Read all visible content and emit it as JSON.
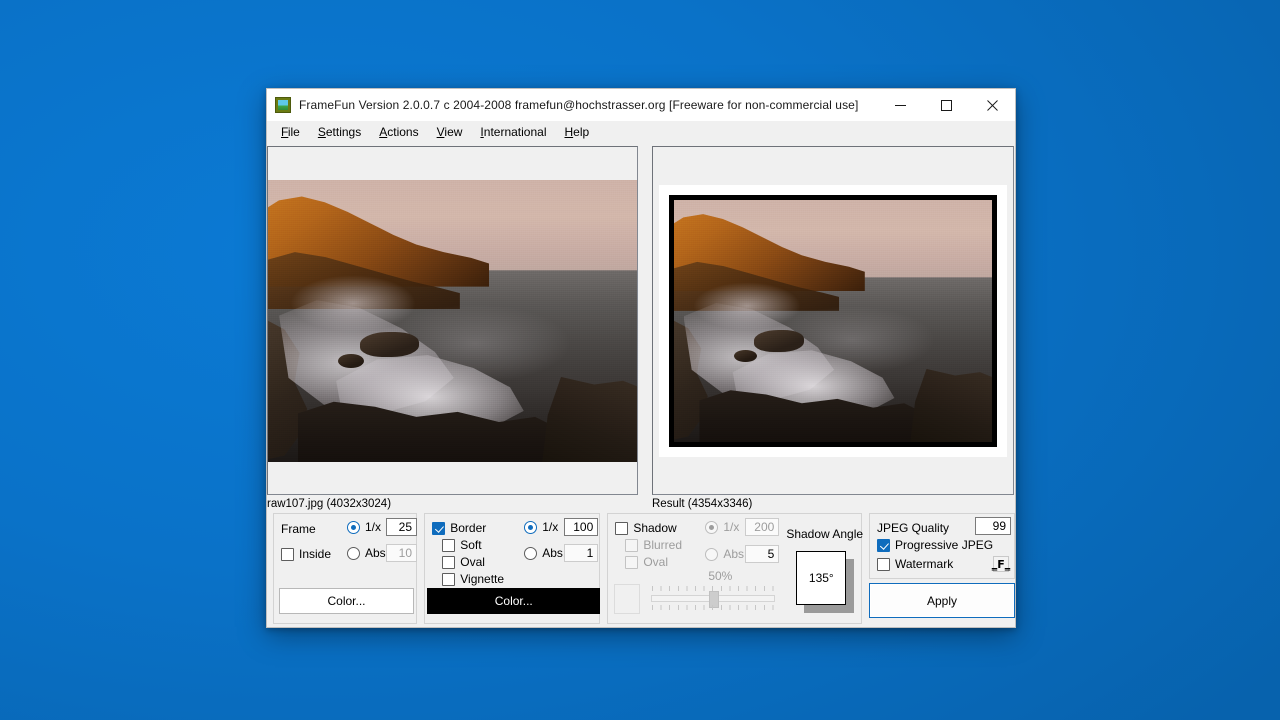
{
  "window": {
    "title": "FrameFun Version 2.0.0.7 c 2004-2008 framefun@hochstrasser.org [Freeware for non-commercial use]",
    "app_icon": "picture-frame-icon",
    "controls": {
      "minimize": "—",
      "maximize": "☐",
      "close": "✕"
    }
  },
  "menu": {
    "items": [
      {
        "label": "File",
        "accel": "F"
      },
      {
        "label": "Settings",
        "accel": "S"
      },
      {
        "label": "Actions",
        "accel": "A"
      },
      {
        "label": "View",
        "accel": "V"
      },
      {
        "label": "International",
        "accel": "I"
      },
      {
        "label": "Help",
        "accel": "H"
      }
    ]
  },
  "previews": {
    "source": {
      "caption": "raw107.jpg (4032x3024)"
    },
    "result": {
      "caption": "Result (4354x3346)"
    }
  },
  "frame_panel": {
    "title": "Frame",
    "inside_label": "Inside",
    "inside_checked": false,
    "mode_1x_label": "1/x",
    "mode_1x_selected": true,
    "mode_1x_value": "25",
    "mode_abs_label": "Abs.",
    "mode_abs_selected": false,
    "mode_abs_value": "10",
    "color_button": "Color...",
    "color_swatch": "#ffffff"
  },
  "border_panel": {
    "title": "Border",
    "border_checked": true,
    "soft_label": "Soft",
    "soft_checked": false,
    "oval_label": "Oval",
    "oval_checked": false,
    "vignette_label": "Vignette",
    "vignette_checked": false,
    "mode_1x_label": "1/x",
    "mode_1x_selected": true,
    "mode_1x_value": "100",
    "mode_abs_label": "Abs.",
    "mode_abs_selected": false,
    "mode_abs_value": "1",
    "color_button": "Color...",
    "color_swatch": "#000000"
  },
  "shadow_panel": {
    "title": "Shadow",
    "shadow_checked": false,
    "enabled": false,
    "blurred_label": "Blurred",
    "blurred_checked": false,
    "oval_label": "Oval",
    "oval_checked": false,
    "mode_1x_label": "1/x",
    "mode_1x_selected": true,
    "mode_1x_value": "200",
    "mode_abs_label": "Abs.",
    "mode_abs_selected": false,
    "mode_abs_value": "5",
    "opacity_label": "50%",
    "opacity_percent": 50,
    "angle_title": "Shadow Angle",
    "angle_value": "135°"
  },
  "jpeg_panel": {
    "quality_label": "JPEG Quality",
    "quality_value": "99",
    "progressive_label": "Progressive JPEG",
    "progressive_checked": true,
    "watermark_label": "Watermark",
    "watermark_checked": false,
    "watermark_icon": "font-picker-icon"
  },
  "apply_button": {
    "label": "Apply"
  },
  "colors": {
    "accent": "#0f6cbd",
    "desktop": "#0a72c8",
    "window_bg": "#f0f0f0",
    "disabled_text": "#9d9d9d"
  }
}
